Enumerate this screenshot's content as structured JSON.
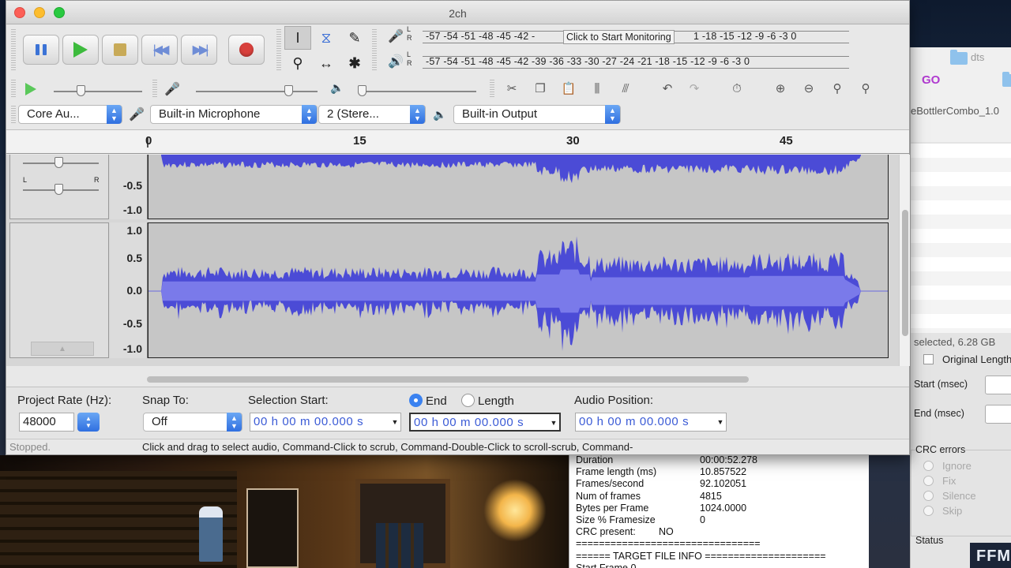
{
  "window": {
    "title": "2ch"
  },
  "transport": {
    "pause": "pause",
    "play": "play",
    "stop": "stop",
    "skip_start": "skip-to-start",
    "skip_end": "skip-to-end",
    "record": "record"
  },
  "meters": {
    "record_scale": "-57 -54 -51 -48 -45 -42 -",
    "record_scale_tail": "1 -18 -15 -12  -9   -6   -3   0",
    "monitor_label": "Click to Start Monitoring",
    "play_scale": "-57 -54 -51 -48 -45 -42 -39 -36 -33 -30 -27 -24 -21 -18 -15 -12  -9   -6   -3   0",
    "lr_label": "L\nR"
  },
  "device_toolbar": {
    "host": "Core Au...",
    "input": "Built-in Microphone",
    "channels": "2 (Stere...",
    "output": "Built-in Output"
  },
  "ruler": {
    "labels": [
      "0",
      "15",
      "30",
      "45"
    ]
  },
  "track": {
    "top_scale": [
      "-0.5",
      "-1.0"
    ],
    "bottom_scale": [
      "1.0",
      "0.5",
      "0.0",
      "-0.5",
      "-1.0"
    ]
  },
  "selection_toolbar": {
    "project_rate_label": "Project Rate (Hz):",
    "project_rate": "48000",
    "snap_label": "Snap To:",
    "snap_value": "Off",
    "selection_start_label": "Selection Start:",
    "end_label": "End",
    "length_label": "Length",
    "audio_position_label": "Audio Position:",
    "start_time": "00 h 00 m 00.000 s",
    "end_time": "00 h 00 m 00.000 s",
    "audio_position": "00 h 00 m 00.000 s"
  },
  "status": {
    "state": "Stopped.",
    "hint": "Click and drag to select audio, Command-Click to scrub, Command-Double-Click to scroll-scrub, Command-"
  },
  "file_info": {
    "rows": [
      {
        "k": "Duration",
        "v": "00:00:52.278"
      },
      {
        "k": "Frame length (ms)",
        "v": "10.857522"
      },
      {
        "k": "Frames/second",
        "v": "92.102051"
      },
      {
        "k": "Num of frames",
        "v": "4815"
      },
      {
        "k": "Bytes per Frame",
        "v": "1024.0000"
      },
      {
        "k": "Size % Framesize",
        "v": "0"
      },
      {
        "k": "CRC present:",
        "v": "NO"
      }
    ],
    "separator": "================================",
    "target_header": "====== TARGET FILE INFO =====================",
    "last_row": "Start Frame       0"
  },
  "right_panel": {
    "folder_name": "dts",
    "go_label": "GO",
    "file_name": "eBottlerCombo_1.0",
    "selected_info": "selected, 6.28 GB",
    "original_length": "Original Length",
    "start_label": "Start (msec)",
    "end_label": "End (msec)",
    "crc_title": "CRC errors",
    "crc_options": [
      "Ignore",
      "Fix",
      "Silence",
      "Skip"
    ],
    "status_title": "Status",
    "brand": "FFM"
  }
}
